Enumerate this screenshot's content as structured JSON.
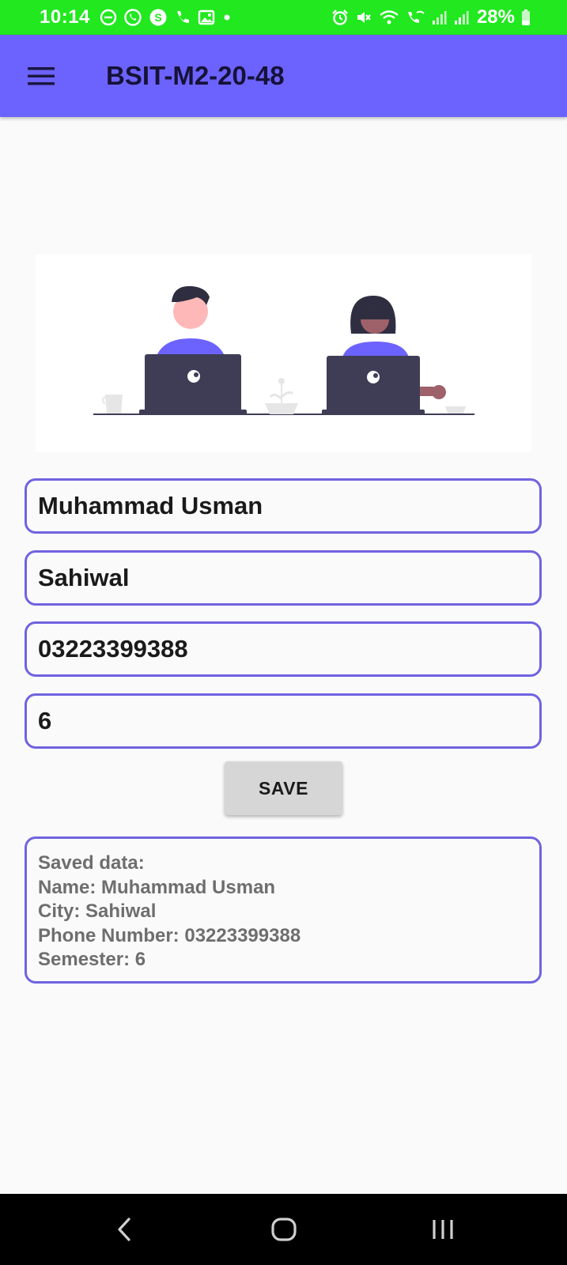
{
  "status_bar": {
    "time": "10:14",
    "battery": "28%",
    "left_icons": [
      "dnd-icon",
      "whatsapp-icon",
      "skype-icon",
      "phone-call-icon",
      "gallery-icon",
      "dot-icon"
    ],
    "right_icons": [
      "alarm-icon",
      "mute-icon",
      "wifi-icon",
      "wifi-call-icon",
      "signal-icon",
      "signal-icon",
      "battery-icon"
    ],
    "background": "#21e81f"
  },
  "app_bar": {
    "title": "BSIT-M2-20-48",
    "menu_icon": "hamburger-menu-icon",
    "background": "#6c63ff"
  },
  "illustration": {
    "description_icon": "people-working-on-laptops-illustration"
  },
  "form": {
    "name": "Muhammad Usman",
    "city": "Sahiwal",
    "phone": "03223399388",
    "semester": "6",
    "save_label": "SAVE",
    "accent": "#6f63e0"
  },
  "saved": {
    "header": "Saved data:",
    "name_line": "Name: Muhammad Usman",
    "city_line": "City: Sahiwal",
    "phone_line": "Phone Number: 03223399388",
    "semester_line": "Semester: 6"
  },
  "nav_bar": {
    "buttons": [
      "back-icon",
      "home-icon",
      "recents-icon"
    ]
  }
}
